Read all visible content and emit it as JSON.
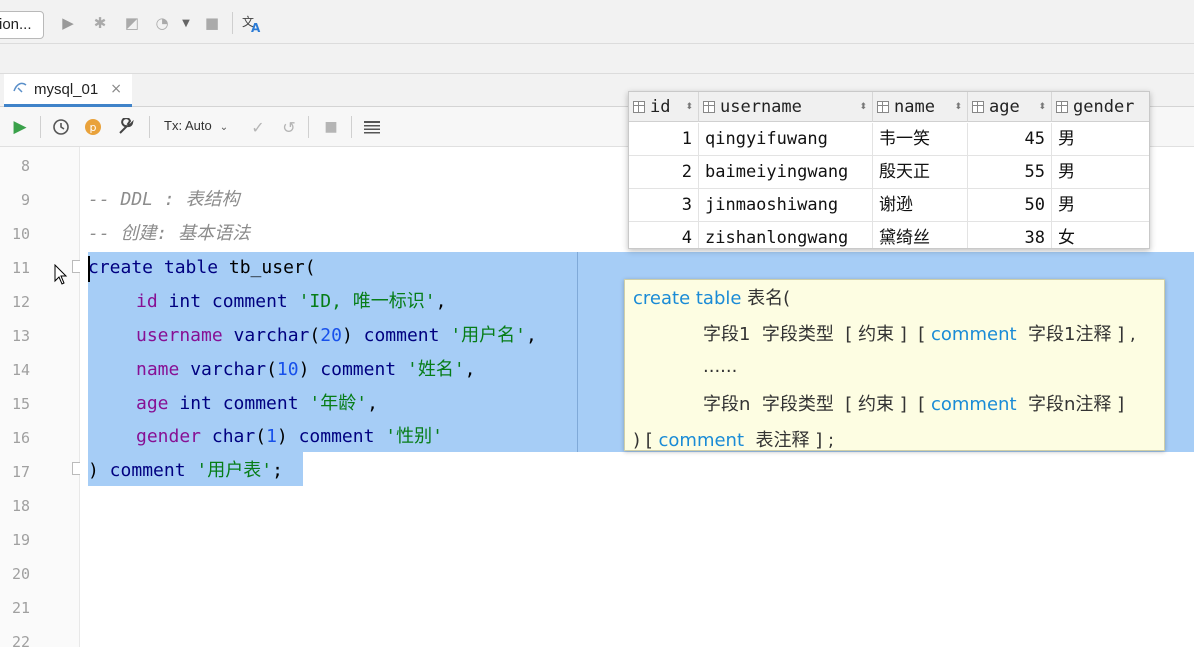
{
  "toolbar": {
    "config_label": "ion...",
    "icons": [
      "run-icon",
      "debug-icon",
      "coverage-icon",
      "profile-icon",
      "dropdown-icon",
      "stop-icon",
      "translate-icon"
    ]
  },
  "tab": {
    "label": "mysql_01",
    "close": "×"
  },
  "editor_toolbar": {
    "tx_mode": "Tx: Auto"
  },
  "line_numbers": [
    "8",
    "9",
    "10",
    "11",
    "12",
    "13",
    "14",
    "15",
    "16",
    "17",
    "18",
    "19",
    "20",
    "21",
    "22"
  ],
  "code": {
    "l9": "-- DDL : 表结构",
    "l10": "-- 创建: 基本语法",
    "l11": {
      "kw1": "create table",
      "rest": " tb_user("
    },
    "l12": {
      "col": "id",
      "type": " int",
      "kw": " comment",
      "str": " 'ID, 唯一标识'",
      "end": ","
    },
    "l13": {
      "col": "username",
      "type": " varchar",
      "p1": "(",
      "num": "20",
      "p2": ")",
      "kw": " comment",
      "str": " '用户名'",
      "end": ","
    },
    "l14": {
      "col": "name",
      "type": " varchar",
      "p1": "(",
      "num": "10",
      "p2": ")",
      "kw": " comment",
      "str": " '姓名'",
      "end": ","
    },
    "l15": {
      "col": "age",
      "type": " int",
      "kw": " comment",
      "str": " '年龄'",
      "end": ","
    },
    "l16": {
      "col": "gender",
      "type": " char",
      "p1": "(",
      "num": "1",
      "p2": ")",
      "kw": " comment",
      "str": " '性别'"
    },
    "l17": {
      "p": ")",
      "kw": " comment",
      "str": " '用户表'",
      "end": ";"
    }
  },
  "result": {
    "columns": [
      "id",
      "username",
      "name",
      "age",
      "gender"
    ],
    "rows": [
      [
        "1",
        "qingyifuwang",
        "韦一笑",
        "45",
        "男"
      ],
      [
        "2",
        "baimeiyingwang",
        "殷天正",
        "55",
        "男"
      ],
      [
        "3",
        "jinmaoshiwang",
        "谢逊",
        "50",
        "男"
      ],
      [
        "4",
        "zishanlongwang",
        "黛绮丝",
        "38",
        "女"
      ]
    ]
  },
  "tooltip": {
    "line1_kw": "create table",
    "line1_rest": " 表名(",
    "line2_a": "字段1  字段类型  [ 约束 ]  [ ",
    "line2_kw": "comment",
    "line2_b": "  字段1注释 ] ,",
    "line3": "......",
    "line4_a": "字段n  字段类型  [ 约束 ]  [ ",
    "line4_kw": "comment",
    "line4_b": "  字段n注释 ]",
    "line5_a": ") [ ",
    "line5_kw": "comment",
    "line5_b": "  表注释 ] ;"
  }
}
